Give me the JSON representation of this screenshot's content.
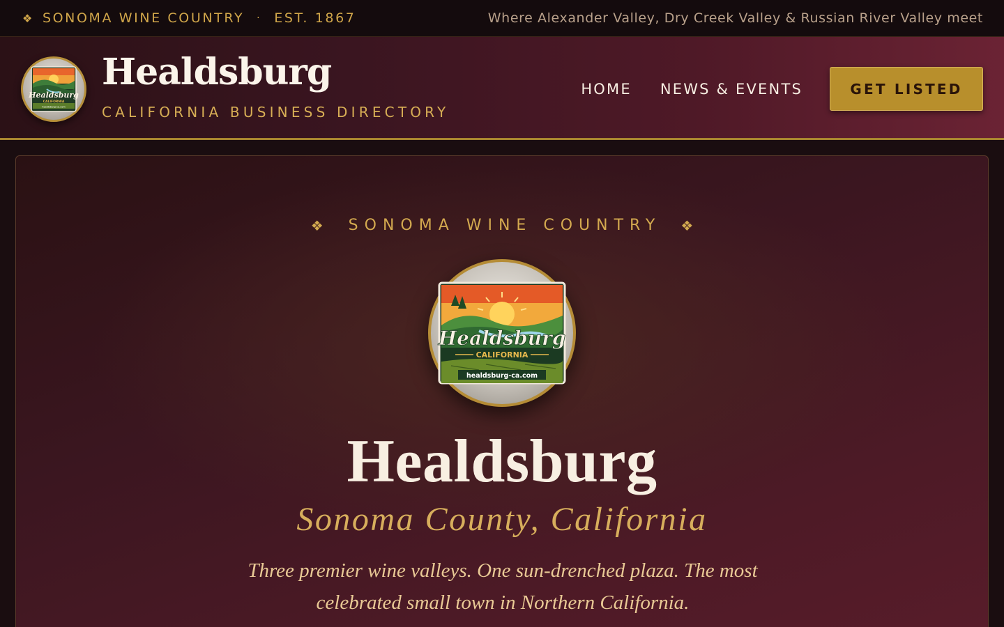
{
  "top_strip": {
    "icon": "diamond-ornament-icon",
    "region": "SONOMA WINE COUNTRY",
    "separator": "·",
    "established": "EST. 1867",
    "valleys": "Where Alexander Valley, Dry Creek Valley & Russian River Valley meet"
  },
  "header": {
    "logo_icon": "healdsburg-badge-logo",
    "title": "Healdsburg",
    "subtitle": "CALIFORNIA BUSINESS DIRECTORY",
    "nav": [
      {
        "label": "HOME"
      },
      {
        "label": "NEWS & EVENTS"
      }
    ],
    "cta_label": "GET LISTED"
  },
  "hero": {
    "eyebrow": "SONOMA WINE COUNTRY",
    "eyebrow_ornament": "❖",
    "badge": {
      "script_title": "Healdsburg",
      "state": "CALIFORNIA",
      "domain": "healdsburg-ca.com"
    },
    "title": "Healdsburg",
    "subtitle": "Sonoma County, California",
    "tagline": "Three premier wine valleys. One sun-drenched plaza. The most celebrated small town in Northern California."
  },
  "colors": {
    "gold": "#d3a94f",
    "wine": "#4f1927",
    "cta": "#b88f2c",
    "cream": "#f8efe2"
  }
}
